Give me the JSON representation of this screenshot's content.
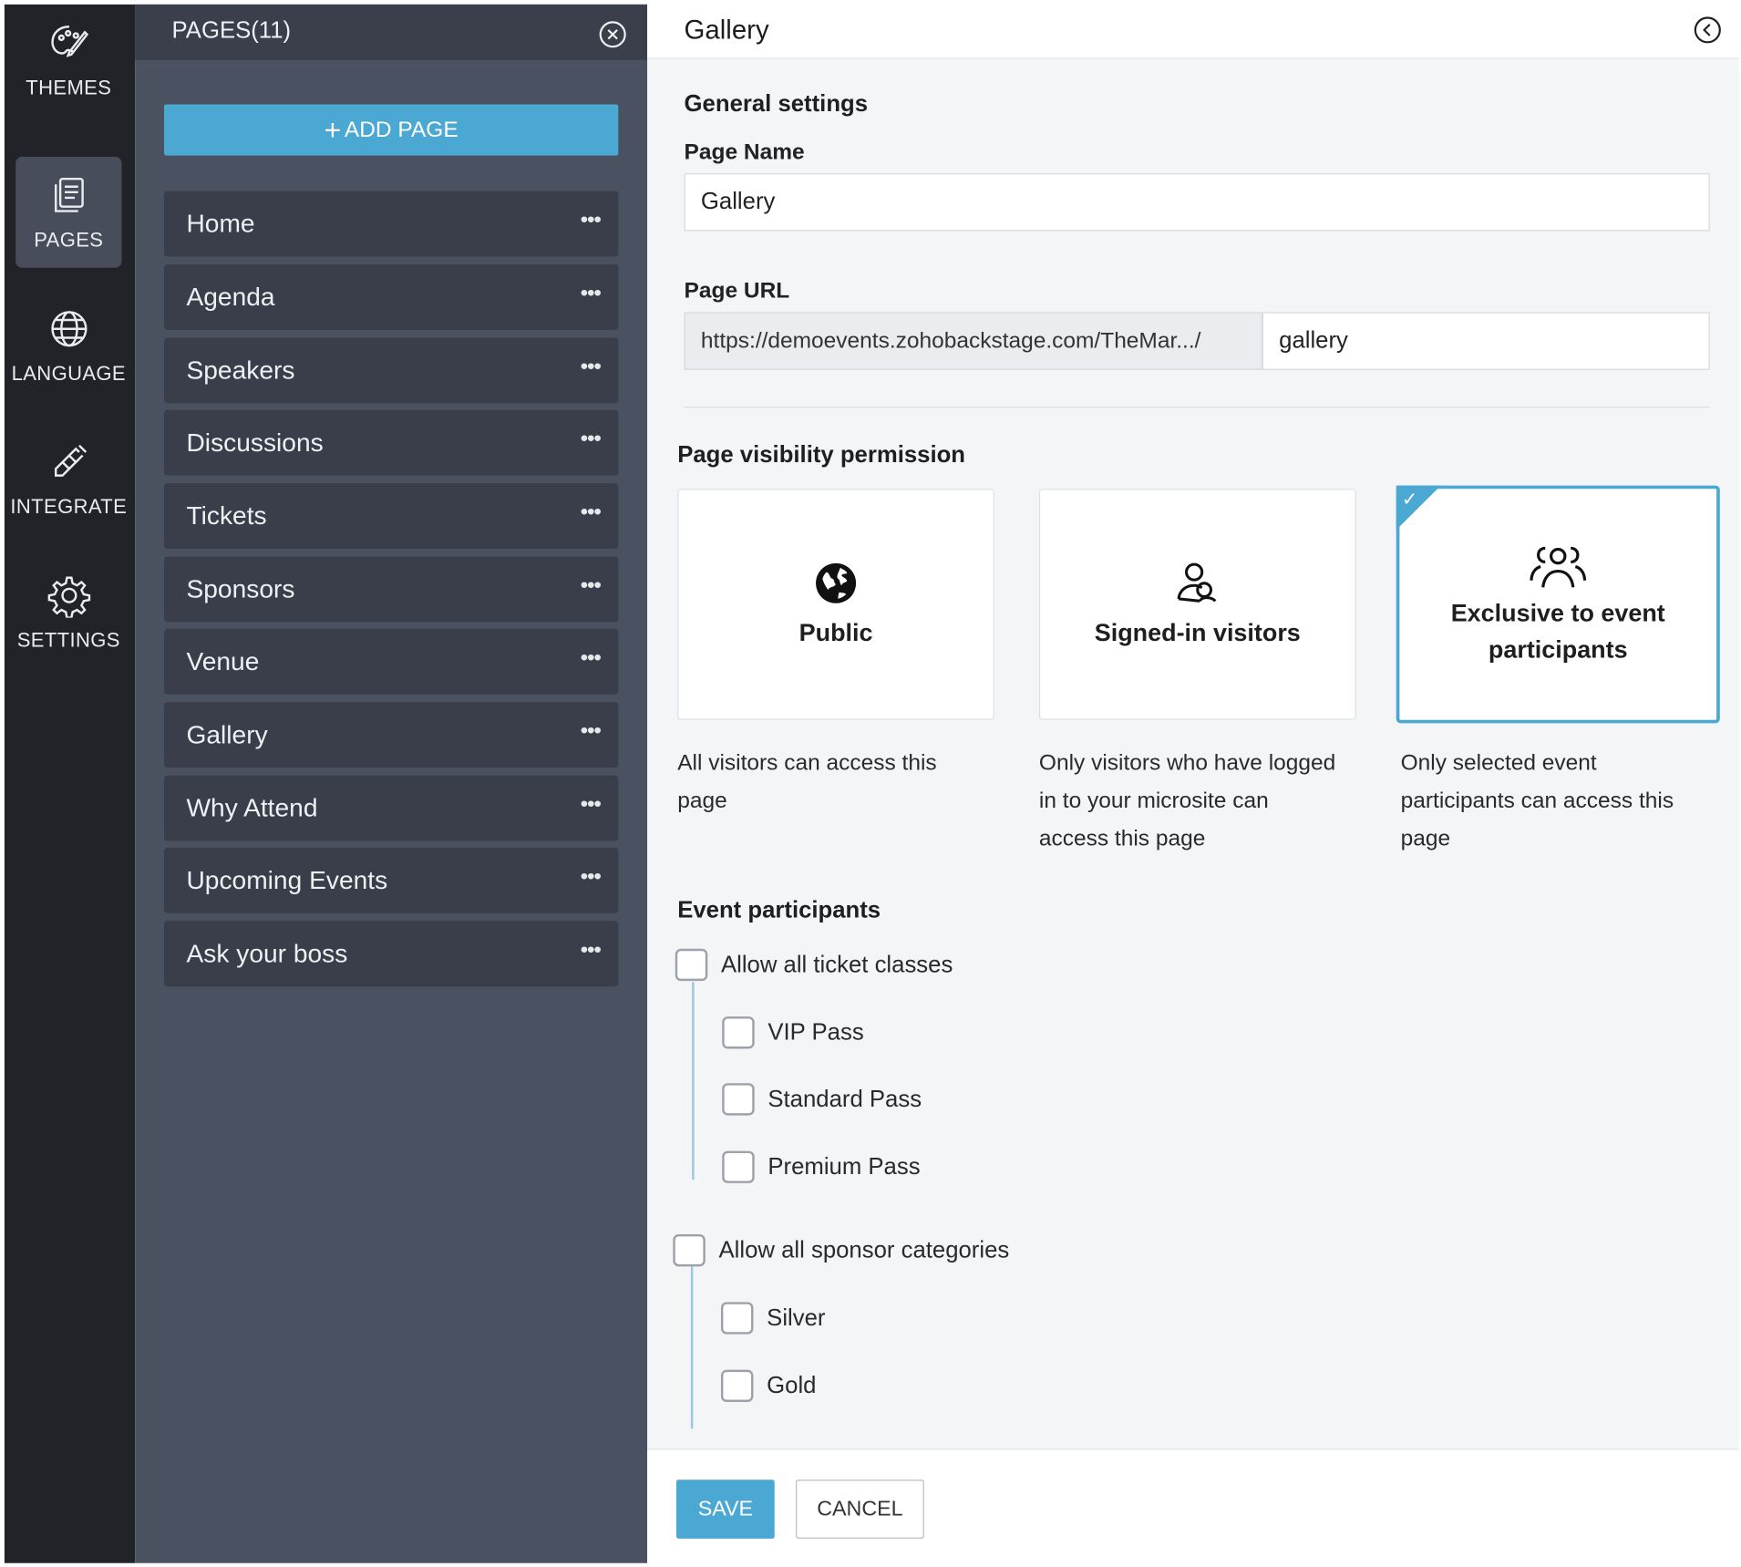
{
  "rail": {
    "items": [
      {
        "label": "THEMES",
        "icon": "palette-icon",
        "active": false
      },
      {
        "label": "PAGES",
        "icon": "pages-icon",
        "active": true
      },
      {
        "label": "LANGUAGE",
        "icon": "globe-icon",
        "active": false
      },
      {
        "label": "INTEGRATE",
        "icon": "integrate-icon",
        "active": false
      },
      {
        "label": "SETTINGS",
        "icon": "gear-icon",
        "active": false
      }
    ]
  },
  "pages_panel": {
    "title": "PAGES(11)",
    "add_page_label": "ADD PAGE",
    "items": [
      {
        "label": "Home"
      },
      {
        "label": "Agenda"
      },
      {
        "label": "Speakers"
      },
      {
        "label": "Discussions"
      },
      {
        "label": "Tickets"
      },
      {
        "label": "Sponsors"
      },
      {
        "label": "Venue"
      },
      {
        "label": "Gallery"
      },
      {
        "label": "Why Attend"
      },
      {
        "label": "Upcoming Events"
      },
      {
        "label": "Ask your boss"
      }
    ]
  },
  "editor": {
    "title": "Gallery",
    "general_settings_title": "General settings",
    "page_name_label": "Page Name",
    "page_name_value": "Gallery",
    "page_url_label": "Page URL",
    "page_url_prefix": "https://demoevents.zohobackstage.com/TheMar.../",
    "page_url_slug": "gallery",
    "visibility_title": "Page visibility permission",
    "visibility_options": [
      {
        "label": "Public",
        "description": "All visitors can access this page",
        "icon": "globe-filled-icon",
        "selected": false
      },
      {
        "label": "Signed-in visitors",
        "description": "Only visitors who have logged in to your microsite can access this page",
        "icon": "signed-in-user-icon",
        "selected": false
      },
      {
        "label": "Exclusive to event participants",
        "description": "Only selected event participants can access this page",
        "icon": "group-icon",
        "selected": true
      }
    ],
    "participants_title": "Event participants",
    "ticket_group": {
      "label": "Allow all ticket classes",
      "checked": false,
      "items": [
        {
          "label": "VIP Pass",
          "checked": false
        },
        {
          "label": "Standard Pass",
          "checked": false
        },
        {
          "label": "Premium Pass",
          "checked": false
        }
      ]
    },
    "sponsor_group": {
      "label": "Allow all sponsor categories",
      "checked": false,
      "items": [
        {
          "label": "Silver",
          "checked": false
        },
        {
          "label": "Gold",
          "checked": false
        }
      ]
    },
    "save_label": "SAVE",
    "cancel_label": "CANCEL"
  },
  "colors": {
    "accent": "#4aa8d2",
    "rail_bg": "#212329",
    "panel_bg": "#4a5160",
    "row_bg": "#393e4a"
  }
}
